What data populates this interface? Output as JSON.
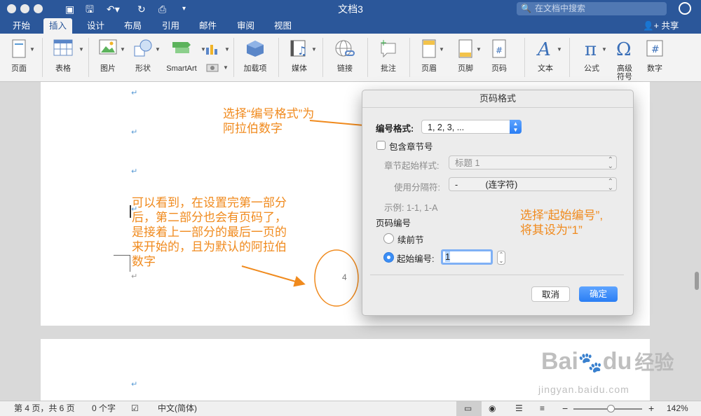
{
  "window": {
    "title": "文档3"
  },
  "search": {
    "placeholder": "在文档中搜索"
  },
  "tabs": [
    "开始",
    "插入",
    "设计",
    "布局",
    "引用",
    "邮件",
    "审阅",
    "视图"
  ],
  "active_tab": "插入",
  "share_label": "共享",
  "ribbon": {
    "page": "页面",
    "table": "表格",
    "picture": "图片",
    "shape": "形状",
    "smartart": "SmartArt",
    "addin": "加载项",
    "media": "媒体",
    "link": "链接",
    "comment": "批注",
    "header": "页眉",
    "footer": "页脚",
    "page_number": "页码",
    "text": "文本",
    "equation": "公式",
    "advanced_symbol_1": "高级",
    "advanced_symbol_2": "符号",
    "number": "数字"
  },
  "document": {
    "page_number_shown": "4"
  },
  "dialog": {
    "title": "页码格式",
    "number_format_label": "编号格式:",
    "number_format_value": "1, 2, 3, ...",
    "include_chapter_label": "包含章节号",
    "chapter_style_label": "章节起始样式:",
    "chapter_style_value": "标题 1",
    "separator_label": "使用分隔符:",
    "separator_value_symbol": "-",
    "separator_value_name": "(连字符)",
    "example_text": "示例:  1-1, 1-A",
    "page_numbering_label": "页码编号",
    "continue_label": "续前节",
    "start_at_label": "起始编号:",
    "start_at_value": "1",
    "cancel_label": "取消",
    "ok_label": "确定"
  },
  "annotations": {
    "a1_line1": "选择“编号格式”为",
    "a1_line2": "阿拉伯数字",
    "a2_line1": "选择“起始编号”,",
    "a2_line2": "将其设为“1”",
    "a3_line1": "可以看到，在设置完第一部分",
    "a3_line2": "后，第二部分也会有页码了，",
    "a3_line3": "是接着上一部分的最后一页的",
    "a3_line4": "来开始的，且为默认的阿拉伯",
    "a3_line5": "数字",
    "color": "#f08a1d"
  },
  "status": {
    "page_info": "第 4 页，共 6 页",
    "word_count": "0 个字",
    "language": "中文(简体)",
    "zoom": "142%",
    "zoom_level_percent": 142
  },
  "watermark": {
    "brand": "Bai",
    "brand2": "du",
    "cn": "经验",
    "url": "jingyan.baidu.com"
  }
}
